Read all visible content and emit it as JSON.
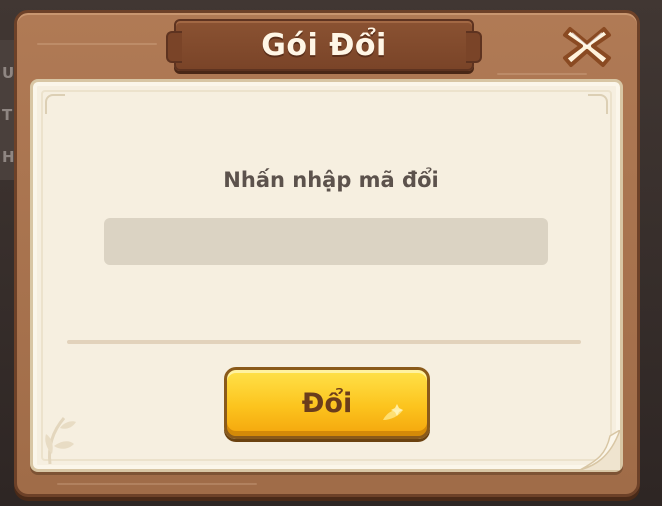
{
  "dialog": {
    "title": "Gói Đổi",
    "prompt": "Nhấn nhập mã đổi",
    "code_input": {
      "value": "",
      "placeholder": ""
    },
    "redeem_button_label": "Đổi",
    "close_icon": "close-x-icon"
  },
  "background": {
    "partial_letters": [
      "U",
      "T",
      "H"
    ]
  },
  "colors": {
    "frame_wood": "#a06c48",
    "title_plaque": "#7a4428",
    "paper": "#f6efe0",
    "input_bg": "#dbd3c3",
    "button_yellow": "#fcc41e",
    "button_text": "#6b3d1c",
    "prompt_text": "#5c524c"
  }
}
